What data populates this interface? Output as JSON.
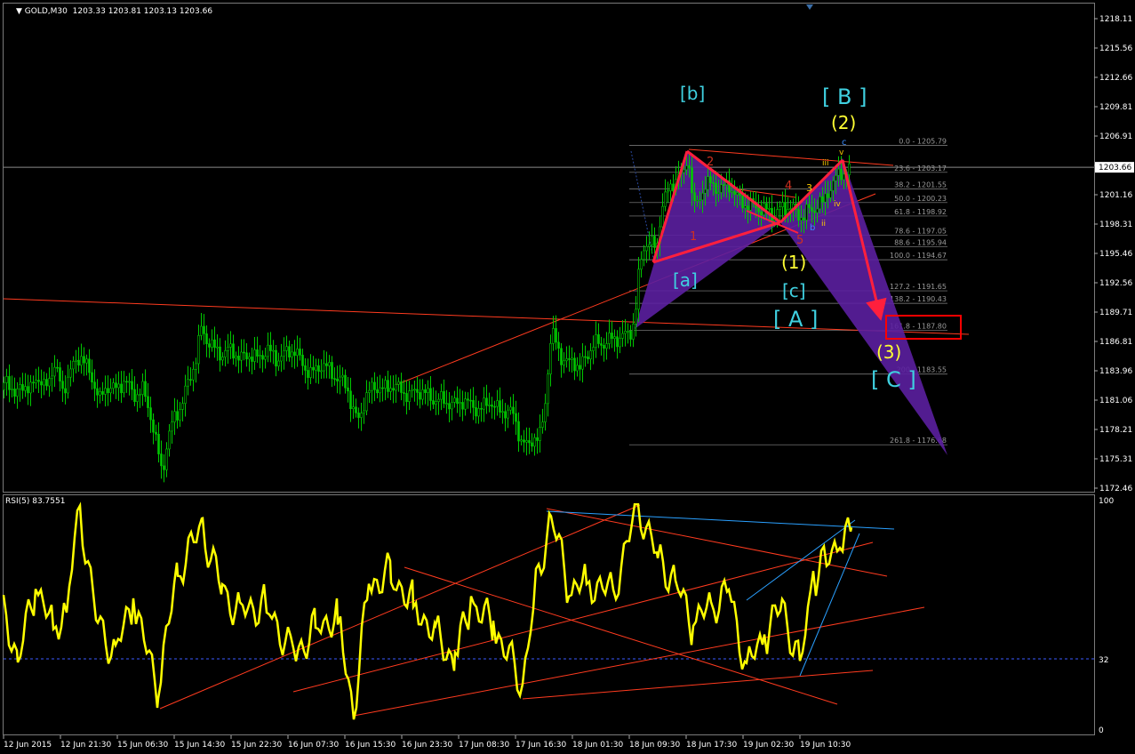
{
  "header": {
    "symbol": "GOLD,M30",
    "ohlc": "1203.33 1203.81 1203.13 1203.66"
  },
  "rsi": {
    "title": "RSI(5) 83.7551",
    "levels": [
      "100",
      "32",
      "0"
    ]
  },
  "colors": {
    "background": "#000000",
    "candle": "#00c800",
    "rsi_line": "#ffff00",
    "trendline": "#ff3b1f",
    "blue_line": "#2aa0ff",
    "pattern_fill": "#5b1fa0",
    "arrow": "#ff1f3d",
    "fib_line": "#8a8a8a",
    "wave_cyan": "#3fd0e0",
    "wave_yellow": "#ffff33",
    "target_box": "#ff0000"
  },
  "chart_data": [
    {
      "type": "candlestick",
      "title": "GOLD,M30",
      "ylim": [
        1172.46,
        1218.11
      ],
      "y_ticks": [
        "1218.11",
        "1215.56",
        "1212.66",
        "1209.81",
        "1206.91",
        "1203.66",
        "1201.16",
        "1198.31",
        "1195.46",
        "1192.56",
        "1189.71",
        "1186.81",
        "1183.96",
        "1181.06",
        "1178.21",
        "1175.31",
        "1172.46"
      ],
      "current_price": "1203.66",
      "x_ticks": [
        "12 Jun 2015",
        "12 Jun 21:30",
        "15 Jun 06:30",
        "15 Jun 14:30",
        "15 Jun 22:30",
        "16 Jun 07:30",
        "16 Jun 15:30",
        "16 Jun 23:30",
        "17 Jun 08:30",
        "17 Jun 16:30",
        "18 Jun 01:30",
        "18 Jun 09:30",
        "18 Jun 17:30",
        "19 Jun 02:30",
        "19 Jun 10:30"
      ],
      "close_path": [
        [
          0,
          1182.0
        ],
        [
          8,
          1183.5
        ],
        [
          16,
          1181.0
        ],
        [
          24,
          1183.0
        ],
        [
          32,
          1181.5
        ],
        [
          40,
          1183.5
        ],
        [
          50,
          1182.0
        ],
        [
          60,
          1184.5
        ],
        [
          70,
          1182.0
        ],
        [
          80,
          1184.0
        ],
        [
          90,
          1185.5
        ],
        [
          98,
          1184.0
        ],
        [
          104,
          1183.0
        ],
        [
          112,
          1181.0
        ],
        [
          120,
          1182.5
        ],
        [
          130,
          1182.0
        ],
        [
          140,
          1183.0
        ],
        [
          150,
          1181.5
        ],
        [
          160,
          1182.0
        ],
        [
          168,
          1180.0
        ],
        [
          176,
          1176.5
        ],
        [
          182,
          1174.0
        ],
        [
          188,
          1177.0
        ],
        [
          196,
          1179.5
        ],
        [
          204,
          1180.5
        ],
        [
          212,
          1183.0
        ],
        [
          220,
          1185.0
        ],
        [
          226,
          1188.0
        ],
        [
          232,
          1187.0
        ],
        [
          240,
          1186.0
        ],
        [
          250,
          1185.5
        ],
        [
          260,
          1186.0
        ],
        [
          270,
          1185.0
        ],
        [
          280,
          1185.5
        ],
        [
          290,
          1185.0
        ],
        [
          300,
          1186.0
        ],
        [
          310,
          1185.0
        ],
        [
          320,
          1185.5
        ],
        [
          330,
          1186.0
        ],
        [
          340,
          1184.5
        ],
        [
          350,
          1183.5
        ],
        [
          360,
          1184.5
        ],
        [
          370,
          1184.0
        ],
        [
          380,
          1183.0
        ],
        [
          390,
          1182.5
        ],
        [
          396,
          1180.0
        ],
        [
          402,
          1179.0
        ],
        [
          410,
          1181.0
        ],
        [
          420,
          1182.5
        ],
        [
          430,
          1182.0
        ],
        [
          440,
          1182.5
        ],
        [
          450,
          1182.0
        ],
        [
          460,
          1181.5
        ],
        [
          470,
          1182.0
        ],
        [
          480,
          1181.5
        ],
        [
          490,
          1181.0
        ],
        [
          500,
          1181.0
        ],
        [
          510,
          1180.5
        ],
        [
          520,
          1181.0
        ],
        [
          530,
          1180.5
        ],
        [
          540,
          1180.0
        ],
        [
          550,
          1181.0
        ],
        [
          560,
          1180.0
        ],
        [
          570,
          1180.0
        ],
        [
          578,
          1179.5
        ],
        [
          586,
          1177.0
        ],
        [
          592,
          1176.5
        ],
        [
          600,
          1177.5
        ],
        [
          606,
          1177.0
        ],
        [
          612,
          1180.0
        ],
        [
          616,
          1184.0
        ],
        [
          620,
          1187.5
        ],
        [
          626,
          1186.5
        ],
        [
          632,
          1185.0
        ],
        [
          638,
          1184.5
        ],
        [
          644,
          1185.0
        ],
        [
          652,
          1184.0
        ],
        [
          660,
          1185.5
        ],
        [
          668,
          1186.5
        ],
        [
          676,
          1186.5
        ],
        [
          684,
          1186.8
        ],
        [
          692,
          1187.0
        ],
        [
          700,
          1187.2
        ],
        [
          708,
          1187.5
        ],
        [
          714,
          1189.0
        ],
        [
          718,
          1193.0
        ],
        [
          724,
          1196.0
        ],
        [
          730,
          1196.5
        ],
        [
          738,
          1195.5
        ],
        [
          744,
          1200.0
        ],
        [
          750,
          1201.0
        ],
        [
          756,
          1202.0
        ],
        [
          762,
          1203.0
        ],
        [
          768,
          1202.5
        ],
        [
          772,
          1204.5
        ],
        [
          776,
          1203.5
        ],
        [
          780,
          1199.5
        ],
        [
          786,
          1200.5
        ],
        [
          792,
          1202.0
        ],
        [
          800,
          1202.0
        ],
        [
          810,
          1201.5
        ],
        [
          820,
          1202.0
        ],
        [
          830,
          1200.5
        ],
        [
          840,
          1200.0
        ],
        [
          850,
          1199.8
        ],
        [
          860,
          1199.5
        ],
        [
          870,
          1199.0
        ],
        [
          876,
          1199.5
        ],
        [
          884,
          1199.7
        ],
        [
          890,
          1200.0
        ],
        [
          896,
          1198.8
        ],
        [
          902,
          1199.0
        ],
        [
          908,
          1199.5
        ],
        [
          914,
          1199.2
        ],
        [
          920,
          1200.5
        ],
        [
          926,
          1200.0
        ],
        [
          932,
          1201.5
        ],
        [
          938,
          1202.5
        ],
        [
          944,
          1202.8
        ],
        [
          950,
          1203.3
        ],
        [
          956,
          1203.6
        ]
      ]
    },
    {
      "type": "line",
      "title": "RSI(5) 83.7551",
      "ylim": [
        0,
        100
      ],
      "reference_level": 32,
      "value": 83.7551
    }
  ],
  "fib_levels": [
    {
      "label": "0.0 - 1205.79",
      "price": 1205.79
    },
    {
      "label": "23.6 - 1203.17",
      "price": 1203.17
    },
    {
      "label": "38.2 - 1201.55",
      "price": 1201.55
    },
    {
      "label": "50.0 - 1200.23",
      "price": 1200.23
    },
    {
      "label": "61.8 - 1198.92",
      "price": 1198.92
    },
    {
      "label": "78.6 - 1197.05",
      "price": 1197.05
    },
    {
      "label": "88.6 - 1195.94",
      "price": 1195.94
    },
    {
      "label": "100.0 - 1194.67",
      "price": 1194.67
    },
    {
      "label": "127.2 - 1191.65",
      "price": 1191.65
    },
    {
      "label": "138.2 - 1190.43",
      "price": 1190.43
    },
    {
      "label": "161.8 - 1187.80",
      "price": 1187.8
    },
    {
      "label": "200 - 1183.55",
      "price": 1183.55
    },
    {
      "label": "261.8 - 1176.68",
      "price": 1176.68
    }
  ],
  "waves": {
    "b_small": "[b]",
    "B_big": "[ B ]",
    "w2": "(2)",
    "c_top": "c",
    "v_top": "v",
    "iii": "iii",
    "iv": "iv",
    "ii": "ii",
    "b_mid": "b",
    "n2": "2",
    "n4": "4",
    "n3": "3",
    "n1": "1",
    "n5": "5",
    "w1": "(1)",
    "a_small": "[a]",
    "c_small": "[c]",
    "A_big": "[ A ]",
    "w3": "(3)",
    "C_big": "[ C ]"
  }
}
